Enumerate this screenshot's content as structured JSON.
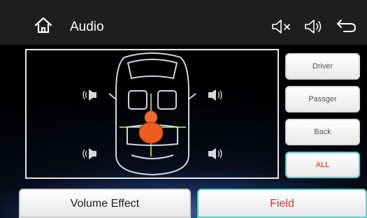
{
  "header": {
    "title": "Audio",
    "icons": [
      "home-icon",
      "mute-icon",
      "volume-icon",
      "back-icon"
    ]
  },
  "side_buttons": [
    {
      "label": "Driver",
      "active": false
    },
    {
      "label": "Passger",
      "active": false
    },
    {
      "label": "Back",
      "active": false
    },
    {
      "label": "ALL",
      "active": true
    }
  ],
  "bottom_tabs": [
    {
      "label": "Volume Effect",
      "active": false
    },
    {
      "label": "Field",
      "active": true
    }
  ],
  "colors": {
    "accent": "#4fd3c9",
    "active_text": "#e03a2a",
    "crosshair": "#c8ff3a"
  }
}
